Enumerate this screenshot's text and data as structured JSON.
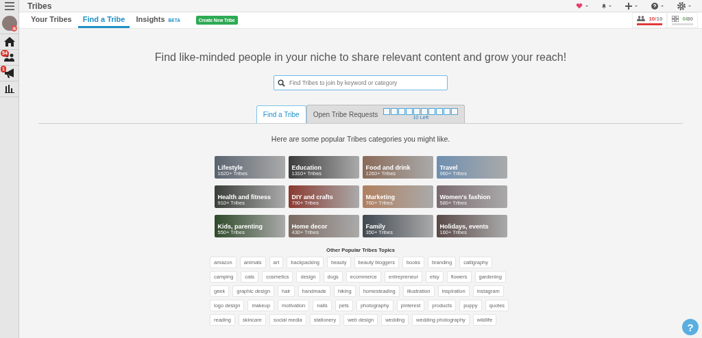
{
  "app_title": "Tribes",
  "sidebar": {
    "avatar_badge": "⊗",
    "items": [
      {
        "kind": "home"
      },
      {
        "kind": "people",
        "badge": "54"
      },
      {
        "kind": "megaphone",
        "badge": "1"
      },
      {
        "kind": "chart"
      }
    ]
  },
  "tabs": [
    {
      "label": "Your Tribes",
      "selected": false
    },
    {
      "label": "Find a Tribe",
      "selected": true
    },
    {
      "label": "Insights",
      "selected": false,
      "tag": "BETA"
    }
  ],
  "create_button": "Create New Tribe",
  "counters": [
    {
      "kind": "people",
      "used": "10",
      "limit": "/10",
      "level": 1
    },
    {
      "kind": "grid",
      "used": "0",
      "limit": "/80",
      "level": 0
    }
  ],
  "headline": "Find like-minded people in your niche to share relevant content and grow your reach!",
  "search": {
    "placeholder": "Find Tribes to join by keyword or category"
  },
  "subtabs": [
    {
      "label": "Find a Tribe",
      "selected": true
    },
    {
      "label": "Open Tribe Requests",
      "selected": false
    }
  ],
  "request_slots": [
    {
      "filled": false
    },
    {
      "filled": false
    },
    {
      "filled": false
    },
    {
      "filled": false
    },
    {
      "filled": false
    },
    {
      "filled": false
    },
    {
      "filled": false
    },
    {
      "filled": false
    },
    {
      "filled": false
    },
    {
      "filled": false
    }
  ],
  "slots_left": "10 Left",
  "intro": "Here are some popular Tribes categories you might like.",
  "categories": [
    {
      "name": "Lifestyle",
      "count": "1620+ Tribes"
    },
    {
      "name": "Education",
      "count": "1310+ Tribes"
    },
    {
      "name": "Food and drink",
      "count": "1260+ Tribes"
    },
    {
      "name": "Travel",
      "count": "960+ Tribes"
    },
    {
      "name": "Health and fitness",
      "count": "910+ Tribes"
    },
    {
      "name": "DIY and crafts",
      "count": "790+ Tribes"
    },
    {
      "name": "Marketing",
      "count": "760+ Tribes"
    },
    {
      "name": "Women's fashion",
      "count": "580+ Tribes"
    },
    {
      "name": "Kids, parenting",
      "count": "550+ Tribes"
    },
    {
      "name": "Home decor",
      "count": "430+ Tribes"
    },
    {
      "name": "Family",
      "count": "350+ Tribes"
    },
    {
      "name": "Holidays, events",
      "count": "160+ Tribes"
    }
  ],
  "topics_title": "Other Popular Tribes Topics",
  "topics": [
    "amazon",
    "animals",
    "art",
    "backpacking",
    "beauty",
    "beauty bloggers",
    "books",
    "branding",
    "calligraphy",
    "camping",
    "cats",
    "cosmetics",
    "design",
    "dogs",
    "ecommerce",
    "entrepreneur",
    "etsy",
    "flowers",
    "gardening",
    "geek",
    "graphic design",
    "hair",
    "handmade",
    "hiking",
    "homesteading",
    "illustration",
    "inspiration",
    "instagram",
    "logo design",
    "makeup",
    "motivation",
    "nails",
    "pets",
    "photography",
    "pinterest",
    "products",
    "puppy",
    "quotes",
    "reading",
    "skincare",
    "social media",
    "stationery",
    "web design",
    "wedding",
    "wedding photography",
    "wildlife"
  ],
  "help_button": "?"
}
